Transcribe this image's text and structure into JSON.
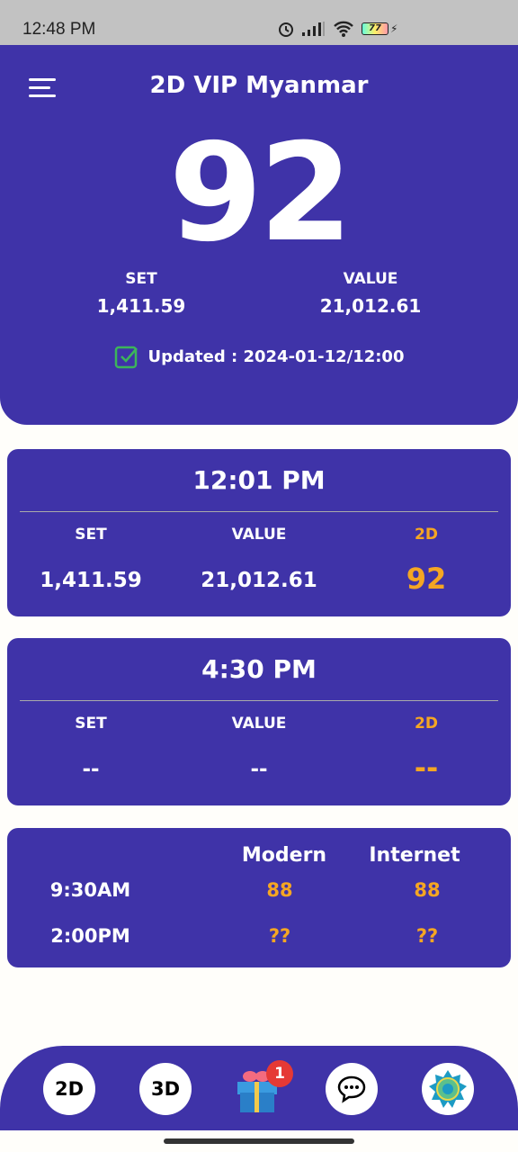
{
  "status_bar": {
    "time": "12:48 PM",
    "battery": "77"
  },
  "header": {
    "title": "2D VIP Myanmar",
    "number": "92",
    "set_label": "SET",
    "set_value": "1,411.59",
    "value_label": "VALUE",
    "value_value": "21,012.61",
    "updated": "Updated : 2024-01-12/12:00"
  },
  "sessions": [
    {
      "time": "12:01 PM",
      "set_label": "SET",
      "value_label": "VALUE",
      "twod_label": "2D",
      "set": "1,411.59",
      "value": "21,012.61",
      "twod": "92"
    },
    {
      "time": "4:30 PM",
      "set_label": "SET",
      "value_label": "VALUE",
      "twod_label": "2D",
      "set": "--",
      "value": "--",
      "twod": "--"
    }
  ],
  "modern_internet": {
    "headers": [
      "Modern",
      "Internet"
    ],
    "rows": [
      {
        "time": "9:30AM",
        "modern": "88",
        "internet": "88"
      },
      {
        "time": "2:00PM",
        "modern": "??",
        "internet": "??"
      }
    ]
  },
  "nav": {
    "twod": "2D",
    "threed": "3D",
    "gift_badge": "1"
  },
  "colors": {
    "primary": "#3f33a8",
    "accent": "#f5a623"
  }
}
